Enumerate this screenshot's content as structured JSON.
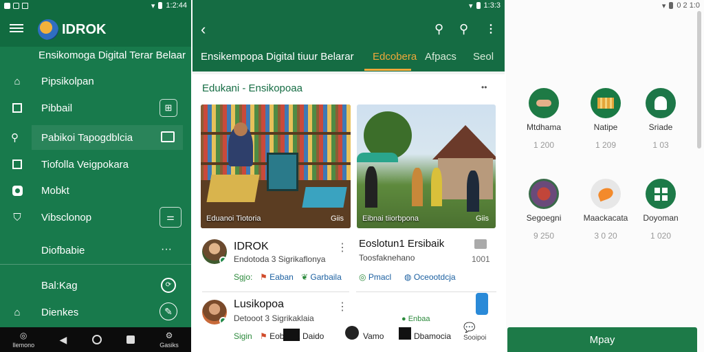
{
  "panel1": {
    "status_time": "1:2:44",
    "app_title": "IDROK",
    "subtitle": "Ensikomoga Digital Terar Belaar",
    "menu": [
      {
        "label": "Pipsikolpan",
        "icon": "home-icon"
      },
      {
        "label": "Pibbail",
        "icon": "book-icon"
      },
      {
        "label": "Pabikoi Tapogdblcia",
        "icon": "search-icon"
      },
      {
        "label": "Tiofolla Veigpokara",
        "icon": "image-icon"
      },
      {
        "label": "Mobkt",
        "icon": "settings-icon"
      },
      {
        "label": "Vibsclonop",
        "icon": "shield-icon"
      },
      {
        "label": "Diofbabie",
        "icon": ""
      },
      {
        "label": "Bal:Kag",
        "icon": ""
      },
      {
        "label": "Dienkes",
        "icon": "home-icon"
      }
    ],
    "more_dots": "···",
    "navbar": {
      "left_label": "Ilemono",
      "right_label": "Gasiks"
    }
  },
  "panel2": {
    "status_time": "1:3:3",
    "header_title": "Ensikempopa Digital tiuur Belarar",
    "tabs": [
      "Edcobera",
      "Afpacs",
      "Seol"
    ],
    "section_title": "Edukani - Ensikopoaa",
    "section_more": "••",
    "images": [
      {
        "caption": "Eduanoi Tiotoria",
        "badge": "Giis"
      },
      {
        "caption": "Eibnai tiiorbpona",
        "badge": "Giis"
      }
    ],
    "list": [
      {
        "title": "IDROK",
        "subtitle": "Endotoda 3 Sigrikaflonya",
        "tag1": "Sgjo:",
        "tag2": "Eaban",
        "tag3": "Garbaila"
      },
      {
        "title": "Eoslotun1 Ersibaik",
        "subtitle": "Toosfaknehano",
        "tag1": "Pmacl",
        "tag2": "Oceootdcja",
        "count": "1001"
      },
      {
        "title": "Lusikopoa",
        "subtitle": "Detooot 3 Sigrikaklaia",
        "tag1": "Sigin",
        "tag2": "Eoblaha",
        "tag3": "Daido",
        "tag4": "Vamo",
        "tag5": "Dbamocia",
        "tag6": "Sooipoi",
        "extra": "Enbaa"
      }
    ]
  },
  "panel3": {
    "status_time": "0 2 1:0",
    "grid": [
      {
        "label": "Mtdhama",
        "value": "1 200",
        "color": "#1e7a45"
      },
      {
        "label": "Natipe",
        "value": "1 209",
        "color": "#1a7a44"
      },
      {
        "label": "Sriade",
        "value": "1 03",
        "color": "#1d7748"
      },
      {
        "label": "Segoegni",
        "value": "9 250",
        "color": "#8d5a43"
      },
      {
        "label": "Maackacata",
        "value": "3 0 20",
        "color": "#f38a2b"
      },
      {
        "label": "Doyoman",
        "value": "1 020",
        "color": "#1d7a48"
      }
    ],
    "apply_label": "Mpay"
  },
  "colors": {
    "primary": "#156c43",
    "accent": "#e39a2a",
    "link": "#1a6fd1"
  }
}
